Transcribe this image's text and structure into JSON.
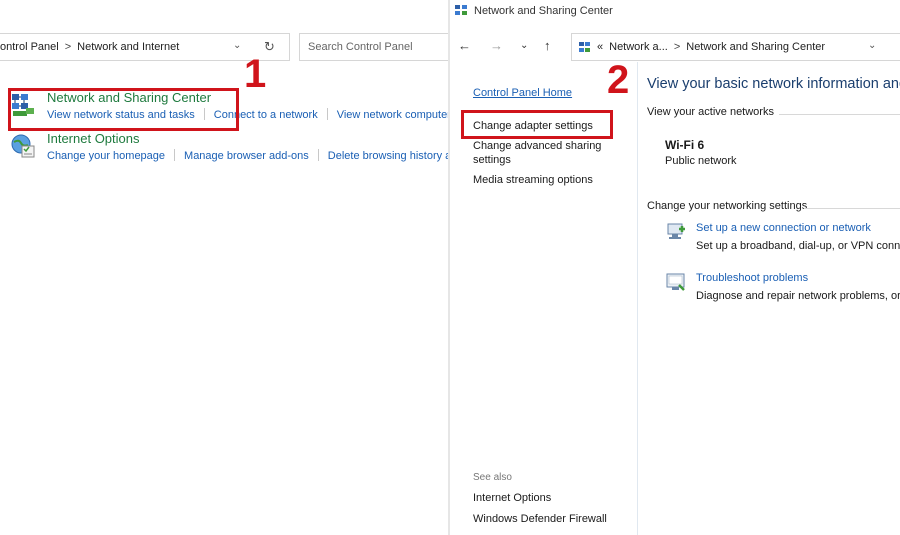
{
  "left": {
    "address": {
      "seg1": "ontrol Panel",
      "sep": ">",
      "seg2": "Network and Internet",
      "dropdown": "⌄",
      "refresh": "↻"
    },
    "search_placeholder": "Search Control Panel",
    "categories": [
      {
        "title": "Network and Sharing Center",
        "links": [
          "View network status and tasks",
          "Connect to a network",
          "View network computers"
        ]
      },
      {
        "title": "Internet Options",
        "links": [
          "Change your homepage",
          "Manage browser add-ons",
          "Delete browsing history an"
        ]
      }
    ],
    "callout_number": "1"
  },
  "right": {
    "window_title": "Network and Sharing Center",
    "nav": {
      "back": "←",
      "forward": "→",
      "recent": "⌄",
      "up": "↑"
    },
    "address": {
      "prefix": "«",
      "seg1": "Network a...",
      "sep": ">",
      "seg2": "Network and Sharing Center",
      "dropdown": "⌄"
    },
    "sidebar": {
      "home": "Control Panel Home",
      "links": [
        "Change adapter settings",
        "Change advanced sharing",
        "settings",
        "Media streaming options"
      ],
      "see_also_label": "See also",
      "see_also": [
        "Internet Options",
        "Windows Defender Firewall"
      ]
    },
    "main": {
      "heading": "View your basic network information and",
      "active_networks_label": "View your active networks",
      "network_name": "Wi-Fi 6",
      "network_type": "Public network",
      "change_settings_label": "Change your networking settings",
      "tasks": [
        {
          "link": "Set up a new connection or network",
          "desc": "Set up a broadband, dial-up, or VPN conne"
        },
        {
          "link": "Troubleshoot problems",
          "desc": "Diagnose and repair network problems, or g"
        }
      ]
    },
    "callout_number": "2"
  },
  "colors": {
    "callout_red": "#d0141b",
    "category_green": "#1e7a3e",
    "link_blue": "#1a5fb4",
    "heading_blue": "#1a3e6e"
  },
  "icons": [
    "network-sharing-icon",
    "internet-options-icon",
    "setup-connection-icon",
    "troubleshoot-icon"
  ]
}
